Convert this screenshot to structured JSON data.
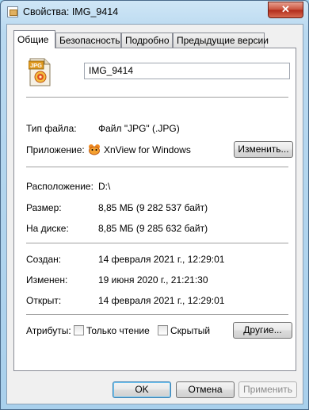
{
  "window": {
    "title": "Свойства: IMG_9414",
    "close_glyph": "✕"
  },
  "tabs": [
    {
      "label": "Общие",
      "active": true
    },
    {
      "label": "Безопасность",
      "active": false
    },
    {
      "label": "Подробно",
      "active": false
    },
    {
      "label": "Предыдущие версии",
      "active": false
    }
  ],
  "general": {
    "file_icon": "jpg-file-icon",
    "file_icon_text": "JPG",
    "file_name": "IMG_9414",
    "type_label": "Тип файла:",
    "type_value": "Файл \"JPG\" (.JPG)",
    "app_label": "Приложение:",
    "app_value": "XnView for Windows",
    "app_icon": "xnview-icon",
    "change_button": "Изменить...",
    "location_label": "Расположение:",
    "location_value": "D:\\",
    "size_label": "Размер:",
    "size_value": "8,85 МБ (9 282 537 байт)",
    "disk_label": "На диске:",
    "disk_value": "8,85 МБ (9 285 632 байт)",
    "created_label": "Создан:",
    "created_value": "14 февраля 2021 г., 12:29:01",
    "modified_label": "Изменен:",
    "modified_value": "19 июня 2020 г., 21:21:30",
    "opened_label": "Открыт:",
    "opened_value": "14 февраля 2021 г., 12:29:01",
    "attributes_label": "Атрибуты:",
    "readonly_label": "Только чтение",
    "readonly_checked": false,
    "hidden_label": "Скрытый",
    "hidden_checked": false,
    "other_button": "Другие..."
  },
  "footer": {
    "ok": "OK",
    "cancel": "Отмена",
    "apply": "Применить"
  },
  "colors": {
    "window_frame": "#a9d0ec",
    "close_button": "#c8503a",
    "default_button_border": "#3c7fb1"
  }
}
